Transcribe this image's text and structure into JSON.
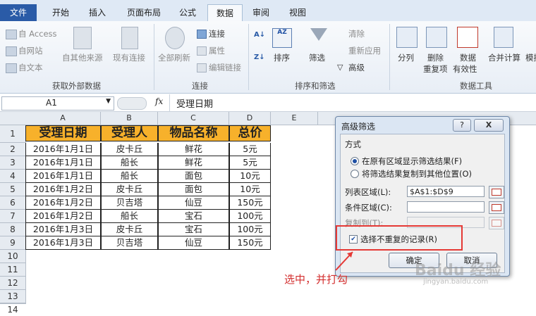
{
  "tabs": [
    "文件",
    "开始",
    "插入",
    "页面布局",
    "公式",
    "数据",
    "审阅",
    "视图"
  ],
  "ribbon": {
    "external": {
      "access": "自 Access",
      "web": "自网站",
      "text": "自文本",
      "other": "自其他来源",
      "existing": "现有连接",
      "group": "获取外部数据"
    },
    "connections": {
      "refresh": "全部刷新",
      "connect": "连接",
      "props": "属性",
      "edit": "编辑链接",
      "group": "连接"
    },
    "sort": {
      "sort": "排序",
      "filter": "筛选",
      "clear": "清除",
      "reapply": "重新应用",
      "advanced": "高级",
      "group": "排序和筛选"
    },
    "tools": {
      "split": "分列",
      "dedupe1": "删除",
      "dedupe2": "重复项",
      "valid1": "数据",
      "valid2": "有效性",
      "merge": "合并计算",
      "sim": "模拟",
      "group": "数据工具"
    }
  },
  "formula_bar": {
    "name_box": "A1",
    "fx": "fx",
    "value": "受理日期"
  },
  "sheet": {
    "columns": [
      "A",
      "B",
      "C",
      "D",
      "E"
    ],
    "rows": [
      "1",
      "2",
      "3",
      "4",
      "5",
      "6",
      "7",
      "8",
      "9",
      "10",
      "11",
      "12",
      "13",
      "14"
    ],
    "header": [
      "受理日期",
      "受理人",
      "物品名称",
      "总价"
    ],
    "data": [
      [
        "2016年1月1日",
        "皮卡丘",
        "鲜花",
        "5元"
      ],
      [
        "2016年1月1日",
        "船长",
        "鲜花",
        "5元"
      ],
      [
        "2016年1月1日",
        "船长",
        "面包",
        "10元"
      ],
      [
        "2016年1月2日",
        "皮卡丘",
        "面包",
        "10元"
      ],
      [
        "2016年1月2日",
        "贝吉塔",
        "仙豆",
        "150元"
      ],
      [
        "2016年1月2日",
        "船长",
        "宝石",
        "100元"
      ],
      [
        "2016年1月3日",
        "皮卡丘",
        "宝石",
        "100元"
      ],
      [
        "2016年1月3日",
        "贝吉塔",
        "仙豆",
        "150元"
      ]
    ]
  },
  "dialog": {
    "title": "高级筛选",
    "help": "?",
    "close": "X",
    "mode_label": "方式",
    "opt1": "在原有区域显示筛选结果(F)",
    "opt2": "将筛选结果复制到其他位置(O)",
    "list_label": "列表区域(L):",
    "list_value": "$A$1:$D$9",
    "criteria_label": "条件区域(C):",
    "copy_label": "复制到(T):",
    "unique_label": "选择不重复的记录(R)",
    "ok": "确定",
    "cancel": "取消"
  },
  "annotation": "选中，并打勾",
  "watermark": "Baidu 经验",
  "watermark_url": "jingyan.baidu.com"
}
